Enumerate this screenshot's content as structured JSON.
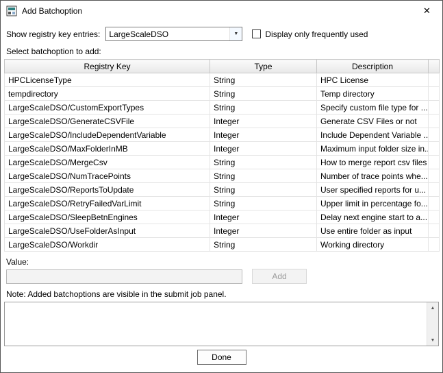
{
  "window": {
    "title": "Add Batchoption",
    "close_glyph": "✕"
  },
  "controls": {
    "registry_label": "Show registry key entries:",
    "registry_value": "LargeScaleDSO",
    "dropdown_arrow_glyph": "▼",
    "checkbox_label": "Display only frequently used",
    "select_label": "Select batchoption to add:",
    "value_label": "Value:",
    "value_text": "",
    "add_label": "Add",
    "note": "Note: Added batchoptions are visible in the submit job panel.",
    "done_label": "Done",
    "scroll_up_glyph": "▲",
    "scroll_down_glyph": "▼"
  },
  "table": {
    "headers": [
      "Registry Key",
      "Type",
      "Description"
    ],
    "rows": [
      {
        "key": "HPCLicenseType",
        "type": "String",
        "desc": "HPC License"
      },
      {
        "key": "tempdirectory",
        "type": "String",
        "desc": "Temp directory"
      },
      {
        "key": "LargeScaleDSO/CustomExportTypes",
        "type": "String",
        "desc": "Specify custom file type for ..."
      },
      {
        "key": "LargeScaleDSO/GenerateCSVFile",
        "type": "Integer",
        "desc": "Generate CSV Files or not"
      },
      {
        "key": "LargeScaleDSO/IncludeDependentVariable",
        "type": "Integer",
        "desc": "Include Dependent Variable ..."
      },
      {
        "key": "LargeScaleDSO/MaxFolderInMB",
        "type": "Integer",
        "desc": "Maximum input folder size in..."
      },
      {
        "key": "LargeScaleDSO/MergeCsv",
        "type": "String",
        "desc": "How to merge report csv files"
      },
      {
        "key": "LargeScaleDSO/NumTracePoints",
        "type": "String",
        "desc": "Number of trace points whe..."
      },
      {
        "key": "LargeScaleDSO/ReportsToUpdate",
        "type": "String",
        "desc": "User specified reports for u..."
      },
      {
        "key": "LargeScaleDSO/RetryFailedVarLimit",
        "type": "String",
        "desc": "Upper limit in percentage fo..."
      },
      {
        "key": "LargeScaleDSO/SleepBetnEngines",
        "type": "Integer",
        "desc": "Delay next engine start to a..."
      },
      {
        "key": "LargeScaleDSO/UseFolderAsInput",
        "type": "Integer",
        "desc": "Use entire folder as input"
      },
      {
        "key": "LargeScaleDSO/Workdir",
        "type": "String",
        "desc": "Working directory"
      }
    ]
  }
}
